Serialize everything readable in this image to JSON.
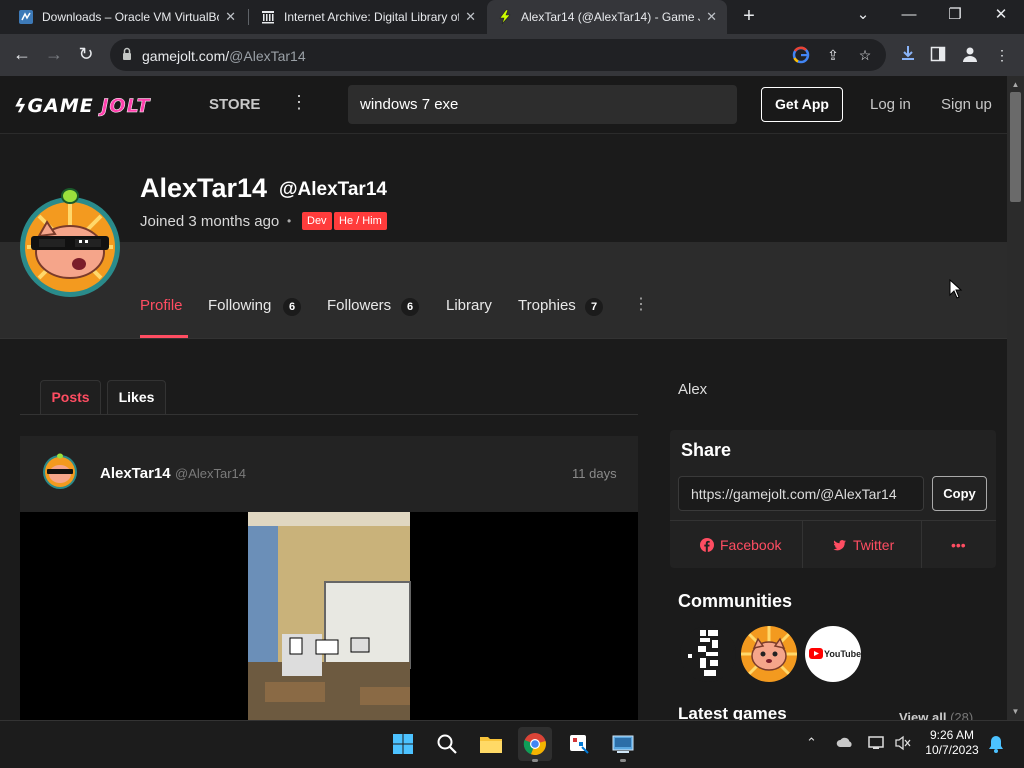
{
  "browser": {
    "tabs": [
      {
        "label": "Downloads – Oracle VM VirtualBox",
        "icon": "virtualbox-icon"
      },
      {
        "label": "Internet Archive: Digital Library of",
        "icon": "archive-icon"
      },
      {
        "label": "AlexTar14 (@AlexTar14) - Game Jolt",
        "icon": "gamejolt-icon",
        "active": true
      }
    ],
    "new_tab": "+",
    "url_host": "gamejolt.com/",
    "url_path": "@AlexTar14"
  },
  "header": {
    "logo_left": "GAME",
    "logo_right": "JOLT",
    "store": "STORE",
    "search_value": "windows 7 exe",
    "get_app": "Get App",
    "login": "Log in",
    "signup": "Sign up"
  },
  "profile": {
    "name": "AlexTar14",
    "handle": "@AlexTar14",
    "joined": "Joined 3 months ago",
    "separator": "•",
    "badges": [
      "Dev",
      "He / Him"
    ],
    "tabs": {
      "profile": "Profile",
      "following": "Following",
      "following_count": "6",
      "followers": "Followers",
      "followers_count": "6",
      "library": "Library",
      "trophies": "Trophies",
      "trophies_count": "7"
    }
  },
  "content": {
    "tabs": [
      "Posts",
      "Likes"
    ],
    "post": {
      "author": "AlexTar14",
      "handle": "@AlexTar14",
      "time": "11 days"
    }
  },
  "sidebar": {
    "display_name": "Alex",
    "share_title": "Share",
    "share_url": "https://gamejolt.com/@AlexTar14",
    "copy": "Copy",
    "facebook": "Facebook",
    "twitter": "Twitter",
    "more": "•••",
    "communities_title": "Communities",
    "youtube_label": "YouTube",
    "latest_games_title": "Latest games",
    "view_all": "View all",
    "view_all_count": "(28)"
  },
  "taskbar": {
    "time": "9:26 AM",
    "date": "10/7/2023"
  },
  "colors": {
    "accent": "#ff4d62",
    "badge_red": "#ff3c3c",
    "background": "#1b1b1b"
  }
}
